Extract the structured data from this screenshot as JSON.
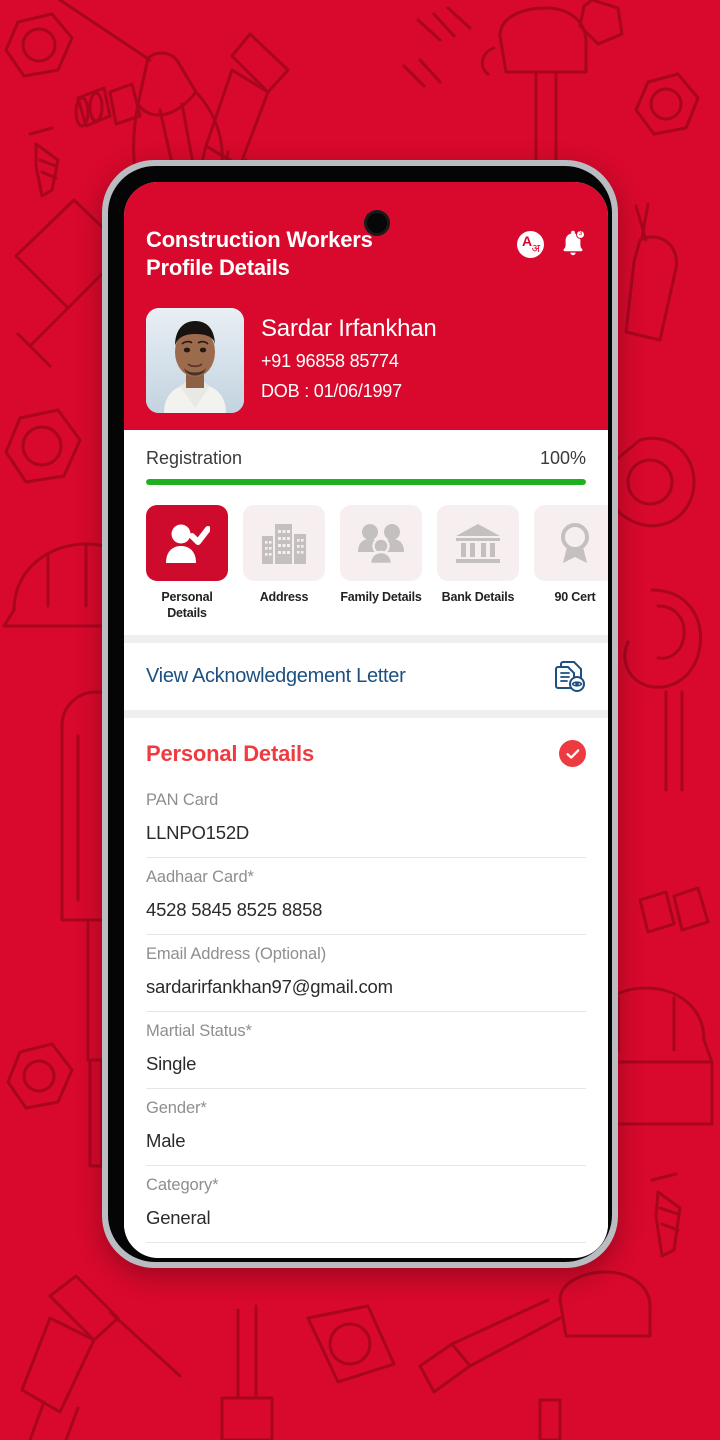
{
  "theme": {
    "brand_red": "#d8092c",
    "accent_red": "#ee3b41",
    "progress_green": "#1fb01f",
    "link_navy": "#1d5080",
    "tab_inactive_bg": "#f7efef"
  },
  "wallpaper": {
    "description": "construction-tools-pattern",
    "background_color": "#d8092c",
    "line_color": "#a8061f"
  },
  "header": {
    "title_line1": "Construction Workers",
    "title_line2": "Profile Details",
    "language_icon": "language-translate-icon",
    "language_glyph_primary": "A",
    "language_glyph_secondary": "अ",
    "notification_icon": "bell-icon",
    "notification_badge": "3"
  },
  "profile": {
    "avatar": "user-photo",
    "name": "Sardar Irfankhan",
    "phone": "+91 96858 85774",
    "dob": "DOB : 01/06/1997"
  },
  "registration": {
    "label": "Registration",
    "percent_text": "100%",
    "percent_value": 100
  },
  "tabs": [
    {
      "label": "Personal Details",
      "icon": "user-check-icon",
      "active": true
    },
    {
      "label": "Address",
      "icon": "building-icon",
      "active": false
    },
    {
      "label": "Family Details",
      "icon": "family-group-icon",
      "active": false
    },
    {
      "label": "Bank Details",
      "icon": "bank-icon",
      "active": false
    },
    {
      "label": "90 Cert",
      "icon": "certificate-icon",
      "active": false
    }
  ],
  "acknowledgement": {
    "label": "View Acknowledgement Letter",
    "icon": "document-view-icon"
  },
  "personal_details": {
    "section_title": "Personal Details",
    "status_icon": "check-circle-icon",
    "fields": [
      {
        "label": "PAN Card",
        "value": "LLNPO152D"
      },
      {
        "label": "Aadhaar Card*",
        "value": "4528 5845 8525 8858"
      },
      {
        "label": "Email Address (Optional)",
        "value": "sardarirfankhan97@gmail.com"
      },
      {
        "label": "Martial Status*",
        "value": "Single"
      },
      {
        "label": "Gender*",
        "value": "Male"
      },
      {
        "label": "Category*",
        "value": "General"
      }
    ]
  }
}
